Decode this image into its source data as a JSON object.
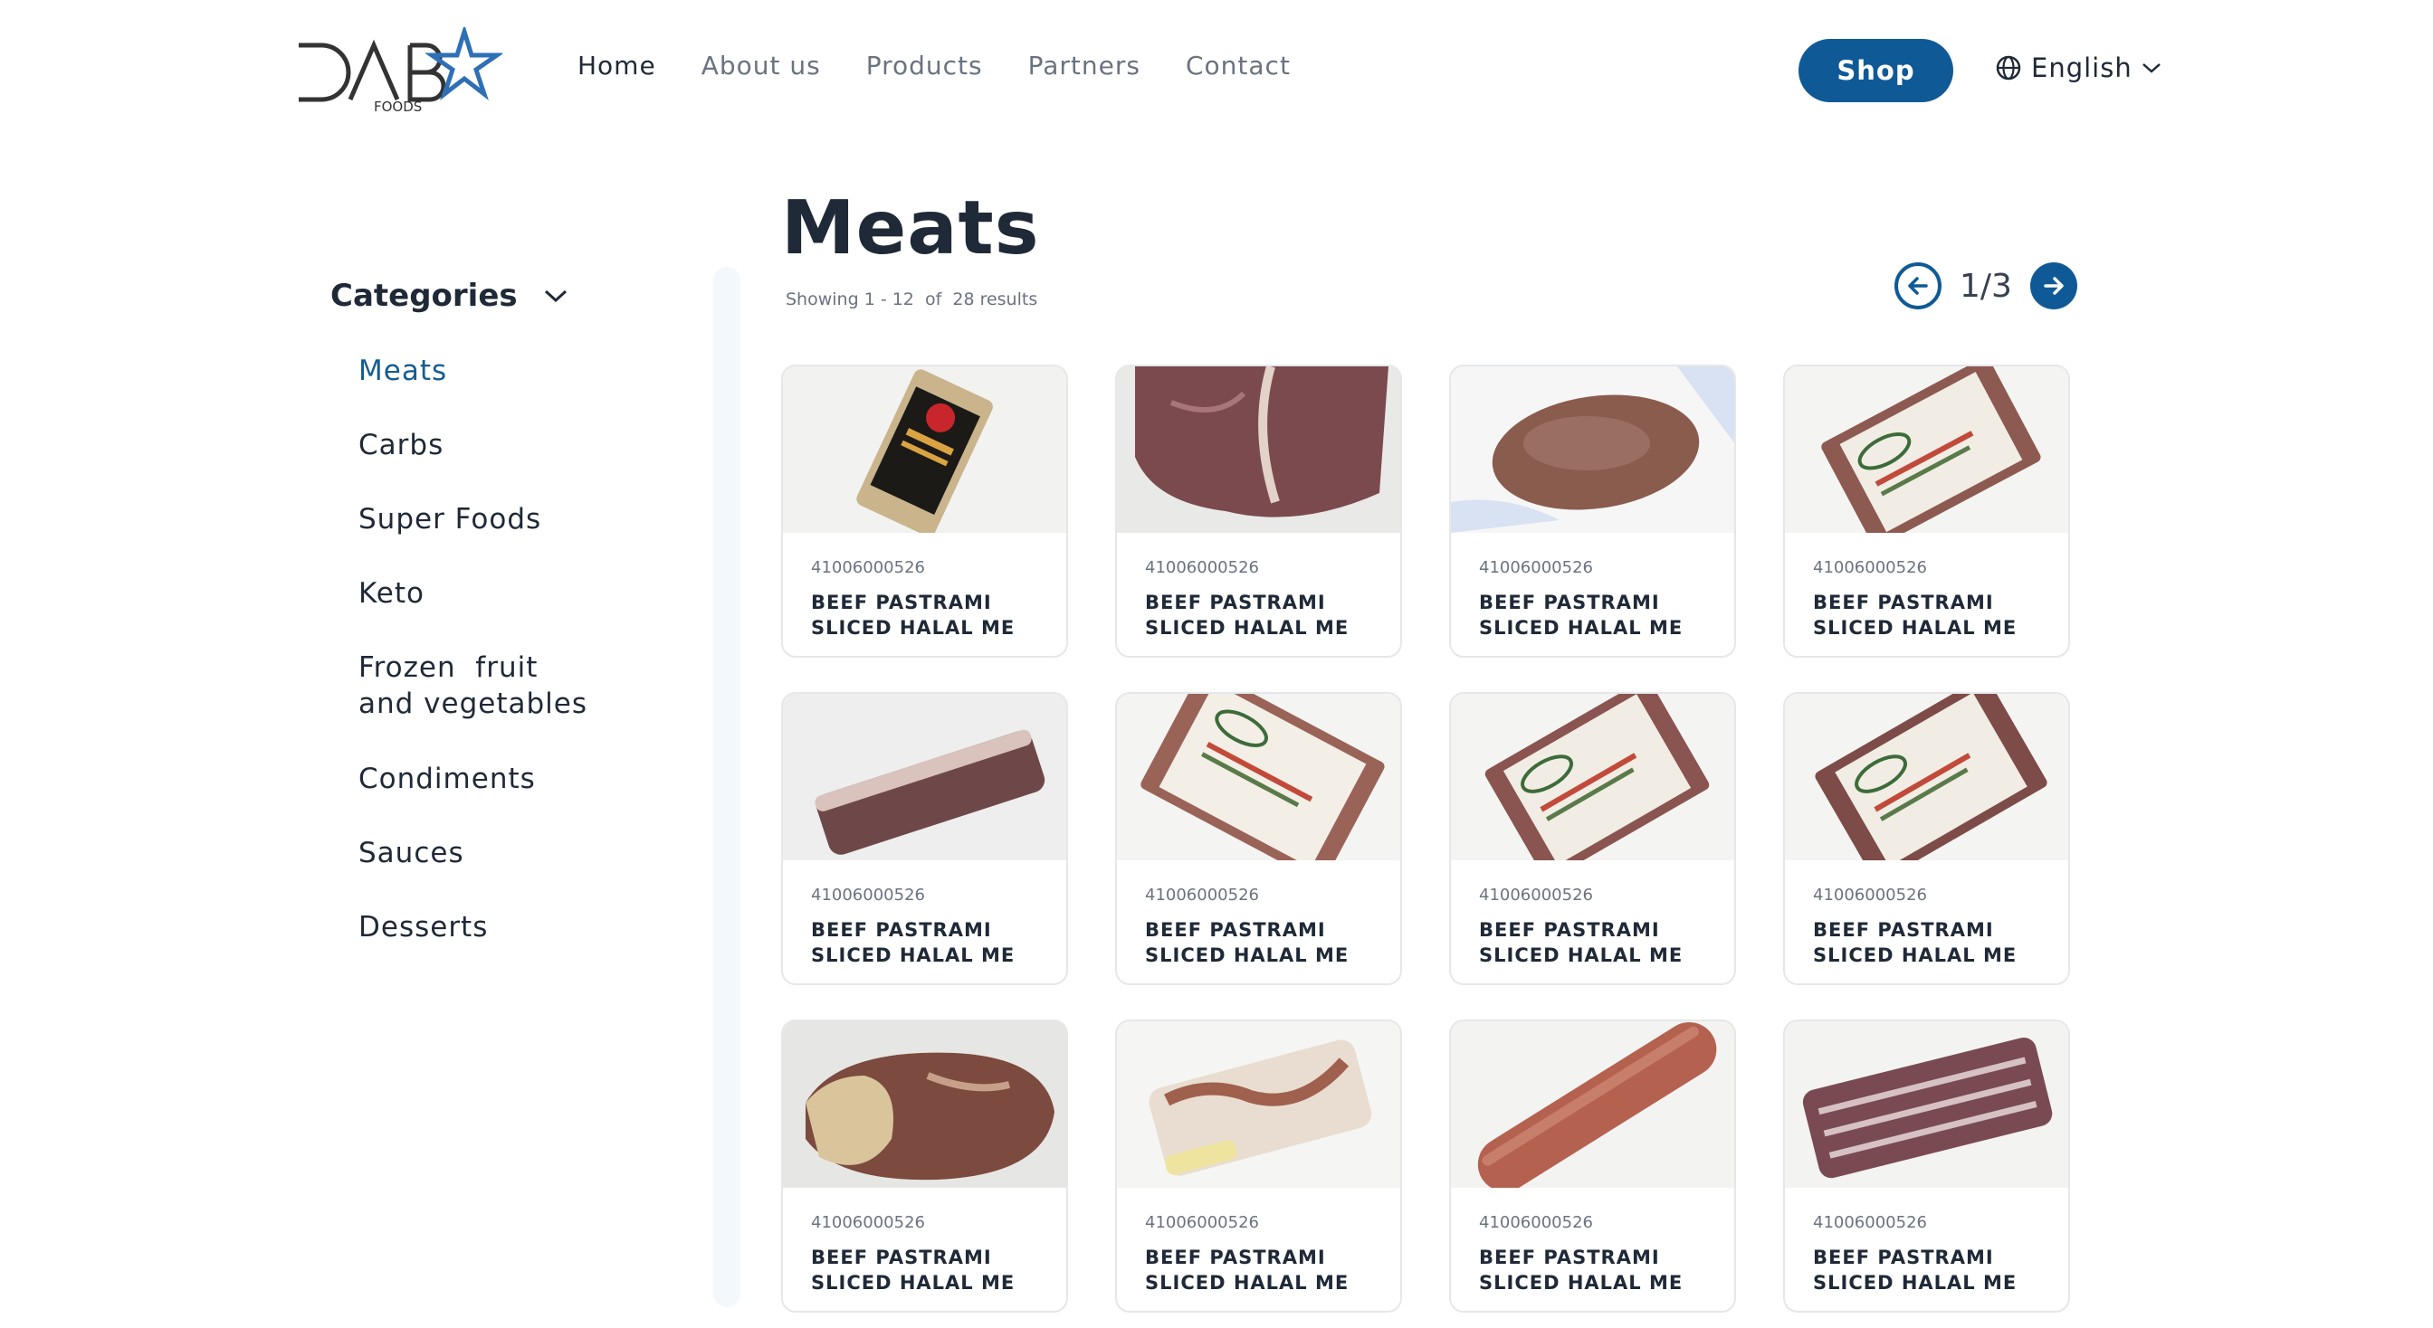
{
  "header": {
    "logo": {
      "text": "DAB",
      "subtext": "FOODS",
      "icon": "star-logo-icon"
    },
    "nav": [
      {
        "label": "Home",
        "active": true
      },
      {
        "label": "About us",
        "active": false
      },
      {
        "label": "Products",
        "active": false
      },
      {
        "label": "Partners",
        "active": false
      },
      {
        "label": "Contact",
        "active": false
      }
    ],
    "shop_label": "Shop",
    "language": {
      "label": "English",
      "icon": "globe-icon"
    }
  },
  "sidebar": {
    "title": "Categories",
    "items": [
      {
        "label": "Meats",
        "active": true
      },
      {
        "label": "Carbs",
        "active": false
      },
      {
        "label": "Super Foods",
        "active": false
      },
      {
        "label": "Keto",
        "active": false
      },
      {
        "label": "Frozen  fruit\nand vegetables",
        "active": false
      },
      {
        "label": "Condiments",
        "active": false
      },
      {
        "label": "Sauces",
        "active": false
      },
      {
        "label": "Desserts",
        "active": false
      }
    ]
  },
  "main": {
    "title": "Meats",
    "results_text": "Showing 1 - 12  of  28 results",
    "pager": {
      "current": "1/3"
    },
    "products": [
      {
        "code": "41006000526",
        "name": "BEEF PASTRAMI SLICED HALAL ME",
        "image": "pepperoni-pack"
      },
      {
        "code": "41006000526",
        "name": "BEEF PASTRAMI SLICED HALAL ME",
        "image": "t-bone-steak"
      },
      {
        "code": "41006000526",
        "name": "BEEF PASTRAMI SLICED HALAL ME",
        "image": "ribeye-vacuum"
      },
      {
        "code": "41006000526",
        "name": "BEEF PASTRAMI SLICED HALAL ME",
        "image": "olive-pastrami-pack"
      },
      {
        "code": "41006000526",
        "name": "BEEF PASTRAMI SLICED HALAL ME",
        "image": "brisket-slab"
      },
      {
        "code": "41006000526",
        "name": "BEEF PASTRAMI SLICED HALAL ME",
        "image": "olive-pepperoni-pack"
      },
      {
        "code": "41006000526",
        "name": "BEEF PASTRAMI SLICED HALAL ME",
        "image": "olive-corned-beef-pack"
      },
      {
        "code": "41006000526",
        "name": "BEEF PASTRAMI SLICED HALAL ME",
        "image": "olive-roast-beef-pack"
      },
      {
        "code": "41006000526",
        "name": "BEEF PASTRAMI SLICED HALAL ME",
        "image": "beef-chunk"
      },
      {
        "code": "41006000526",
        "name": "BEEF PASTRAMI SLICED HALAL ME",
        "image": "frozen-fat-block"
      },
      {
        "code": "41006000526",
        "name": "BEEF PASTRAMI SLICED HALAL ME",
        "image": "sausage-log"
      },
      {
        "code": "41006000526",
        "name": "BEEF PASTRAMI SLICED HALAL ME",
        "image": "short-ribs-pack"
      }
    ]
  },
  "colors": {
    "accent": "#0f5a96",
    "active_text": "#155c91",
    "scrollbar": "#f3f8fd"
  }
}
